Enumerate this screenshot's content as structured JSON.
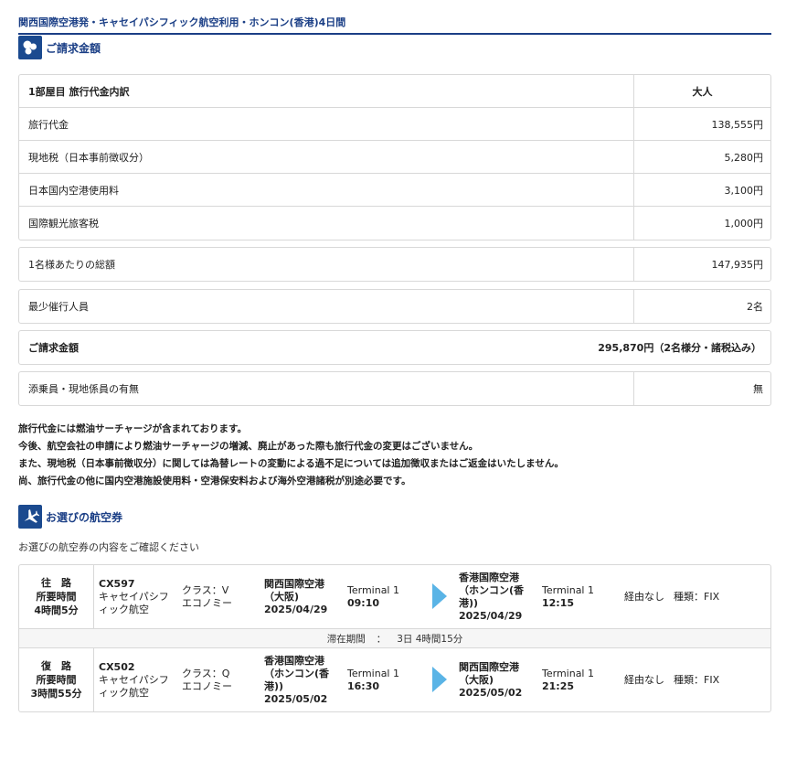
{
  "tour_title": "関西国際空港発・キャセイパシフィック航空利用・ホンコン(香港)4日間",
  "billing": {
    "section_title": "ご請求金額",
    "header_label": "1部屋目 旅行代金内訳",
    "header_col": "大人",
    "items": [
      {
        "label": "旅行代金",
        "value": "138,555円"
      },
      {
        "label": "現地税（日本事前徴収分）",
        "value": "5,280円"
      },
      {
        "label": "日本国内空港使用料",
        "value": "3,100円"
      },
      {
        "label": "国際観光旅客税",
        "value": "1,000円"
      }
    ],
    "per_person_label": "1名様あたりの総額",
    "per_person_value": "147,935円",
    "min_pax_label": "最少催行人員",
    "min_pax_value": "2名",
    "total_label": "ご請求金額",
    "total_value": "295,870円（2名様分・諸税込み）",
    "escort_label": "添乗員・現地係員の有無",
    "escort_value": "無"
  },
  "notes": [
    "旅行代金には燃油サーチャージが含まれております。",
    "今後、航空会社の申請により燃油サーチャージの増減、廃止があった際も旅行代金の変更はございません。",
    "また、現地税（日本事前徴収分）に関しては為替レートの変動による過不足については追加徴収またはご返金はいたしません。",
    "尚、旅行代金の他に国内空港施設使用料・空港保安料および海外空港諸税が別途必要です。"
  ],
  "flights_section": {
    "title": "お選びの航空券",
    "subtitle": "お選びの航空券の内容をご確認ください",
    "stay_label": "滞在期間",
    "stay_sep": "：",
    "stay_value": "3日 4時間15分",
    "legs": [
      {
        "dir": "往　路",
        "duration_label": "所要時間",
        "duration": "4時間5分",
        "flight_no": "CX597",
        "airline_1": "キャセイパシフ",
        "airline_2": "ィック航空",
        "class_label": "クラス：V",
        "class_name": "エコノミー",
        "dep_airport_1": "関西国際空港",
        "dep_airport_2": "（大阪)",
        "dep_airport_3": "",
        "dep_date": "2025/04/29",
        "dep_terminal": "Terminal 1",
        "dep_time": "09:10",
        "arr_airport_1": "香港国際空港",
        "arr_airport_2": "（ホンコン(香",
        "arr_airport_3": "港))",
        "arr_date": "2025/04/29",
        "arr_terminal": "Terminal 1",
        "arr_time": "12:15",
        "via": "経由なし",
        "fare_type": "種類：FIX"
      },
      {
        "dir": "復　路",
        "duration_label": "所要時間",
        "duration": "3時間55分",
        "flight_no": "CX502",
        "airline_1": "キャセイパシフ",
        "airline_2": "ィック航空",
        "class_label": "クラス：Q",
        "class_name": "エコノミー",
        "dep_airport_1": "香港国際空港",
        "dep_airport_2": "（ホンコン(香",
        "dep_airport_3": "港))",
        "dep_date": "2025/05/02",
        "dep_terminal": "Terminal 1",
        "dep_time": "16:30",
        "arr_airport_1": "関西国際空港",
        "arr_airport_2": "（大阪)",
        "arr_airport_3": "",
        "arr_date": "2025/05/02",
        "arr_terminal": "Terminal 1",
        "arr_time": "21:25",
        "via": "経由なし",
        "fare_type": "種類：FIX"
      }
    ]
  },
  "icons": {
    "billing": "coins-icon",
    "flights": "airplane-icon"
  },
  "colors": {
    "brand": "#1b3f86",
    "arrow": "#5ab4e6"
  }
}
